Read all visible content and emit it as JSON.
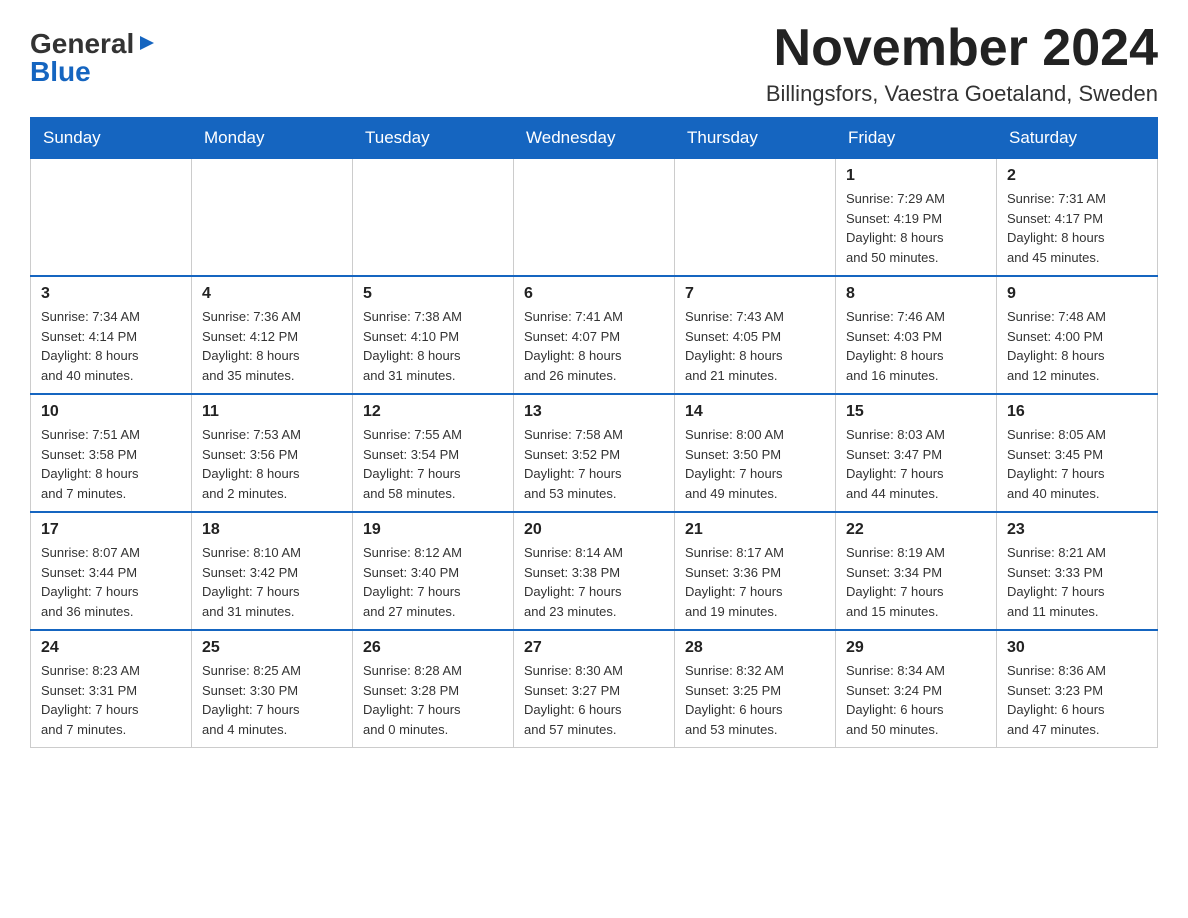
{
  "header": {
    "logo": {
      "general": "General",
      "blue": "Blue",
      "arrow": "▶"
    },
    "title": "November 2024",
    "location": "Billingsfors, Vaestra Goetaland, Sweden"
  },
  "days_of_week": [
    "Sunday",
    "Monday",
    "Tuesday",
    "Wednesday",
    "Thursday",
    "Friday",
    "Saturday"
  ],
  "weeks": [
    [
      {
        "day": "",
        "info": ""
      },
      {
        "day": "",
        "info": ""
      },
      {
        "day": "",
        "info": ""
      },
      {
        "day": "",
        "info": ""
      },
      {
        "day": "",
        "info": ""
      },
      {
        "day": "1",
        "info": "Sunrise: 7:29 AM\nSunset: 4:19 PM\nDaylight: 8 hours\nand 50 minutes."
      },
      {
        "day": "2",
        "info": "Sunrise: 7:31 AM\nSunset: 4:17 PM\nDaylight: 8 hours\nand 45 minutes."
      }
    ],
    [
      {
        "day": "3",
        "info": "Sunrise: 7:34 AM\nSunset: 4:14 PM\nDaylight: 8 hours\nand 40 minutes."
      },
      {
        "day": "4",
        "info": "Sunrise: 7:36 AM\nSunset: 4:12 PM\nDaylight: 8 hours\nand 35 minutes."
      },
      {
        "day": "5",
        "info": "Sunrise: 7:38 AM\nSunset: 4:10 PM\nDaylight: 8 hours\nand 31 minutes."
      },
      {
        "day": "6",
        "info": "Sunrise: 7:41 AM\nSunset: 4:07 PM\nDaylight: 8 hours\nand 26 minutes."
      },
      {
        "day": "7",
        "info": "Sunrise: 7:43 AM\nSunset: 4:05 PM\nDaylight: 8 hours\nand 21 minutes."
      },
      {
        "day": "8",
        "info": "Sunrise: 7:46 AM\nSunset: 4:03 PM\nDaylight: 8 hours\nand 16 minutes."
      },
      {
        "day": "9",
        "info": "Sunrise: 7:48 AM\nSunset: 4:00 PM\nDaylight: 8 hours\nand 12 minutes."
      }
    ],
    [
      {
        "day": "10",
        "info": "Sunrise: 7:51 AM\nSunset: 3:58 PM\nDaylight: 8 hours\nand 7 minutes."
      },
      {
        "day": "11",
        "info": "Sunrise: 7:53 AM\nSunset: 3:56 PM\nDaylight: 8 hours\nand 2 minutes."
      },
      {
        "day": "12",
        "info": "Sunrise: 7:55 AM\nSunset: 3:54 PM\nDaylight: 7 hours\nand 58 minutes."
      },
      {
        "day": "13",
        "info": "Sunrise: 7:58 AM\nSunset: 3:52 PM\nDaylight: 7 hours\nand 53 minutes."
      },
      {
        "day": "14",
        "info": "Sunrise: 8:00 AM\nSunset: 3:50 PM\nDaylight: 7 hours\nand 49 minutes."
      },
      {
        "day": "15",
        "info": "Sunrise: 8:03 AM\nSunset: 3:47 PM\nDaylight: 7 hours\nand 44 minutes."
      },
      {
        "day": "16",
        "info": "Sunrise: 8:05 AM\nSunset: 3:45 PM\nDaylight: 7 hours\nand 40 minutes."
      }
    ],
    [
      {
        "day": "17",
        "info": "Sunrise: 8:07 AM\nSunset: 3:44 PM\nDaylight: 7 hours\nand 36 minutes."
      },
      {
        "day": "18",
        "info": "Sunrise: 8:10 AM\nSunset: 3:42 PM\nDaylight: 7 hours\nand 31 minutes."
      },
      {
        "day": "19",
        "info": "Sunrise: 8:12 AM\nSunset: 3:40 PM\nDaylight: 7 hours\nand 27 minutes."
      },
      {
        "day": "20",
        "info": "Sunrise: 8:14 AM\nSunset: 3:38 PM\nDaylight: 7 hours\nand 23 minutes."
      },
      {
        "day": "21",
        "info": "Sunrise: 8:17 AM\nSunset: 3:36 PM\nDaylight: 7 hours\nand 19 minutes."
      },
      {
        "day": "22",
        "info": "Sunrise: 8:19 AM\nSunset: 3:34 PM\nDaylight: 7 hours\nand 15 minutes."
      },
      {
        "day": "23",
        "info": "Sunrise: 8:21 AM\nSunset: 3:33 PM\nDaylight: 7 hours\nand 11 minutes."
      }
    ],
    [
      {
        "day": "24",
        "info": "Sunrise: 8:23 AM\nSunset: 3:31 PM\nDaylight: 7 hours\nand 7 minutes."
      },
      {
        "day": "25",
        "info": "Sunrise: 8:25 AM\nSunset: 3:30 PM\nDaylight: 7 hours\nand 4 minutes."
      },
      {
        "day": "26",
        "info": "Sunrise: 8:28 AM\nSunset: 3:28 PM\nDaylight: 7 hours\nand 0 minutes."
      },
      {
        "day": "27",
        "info": "Sunrise: 8:30 AM\nSunset: 3:27 PM\nDaylight: 6 hours\nand 57 minutes."
      },
      {
        "day": "28",
        "info": "Sunrise: 8:32 AM\nSunset: 3:25 PM\nDaylight: 6 hours\nand 53 minutes."
      },
      {
        "day": "29",
        "info": "Sunrise: 8:34 AM\nSunset: 3:24 PM\nDaylight: 6 hours\nand 50 minutes."
      },
      {
        "day": "30",
        "info": "Sunrise: 8:36 AM\nSunset: 3:23 PM\nDaylight: 6 hours\nand 47 minutes."
      }
    ]
  ]
}
